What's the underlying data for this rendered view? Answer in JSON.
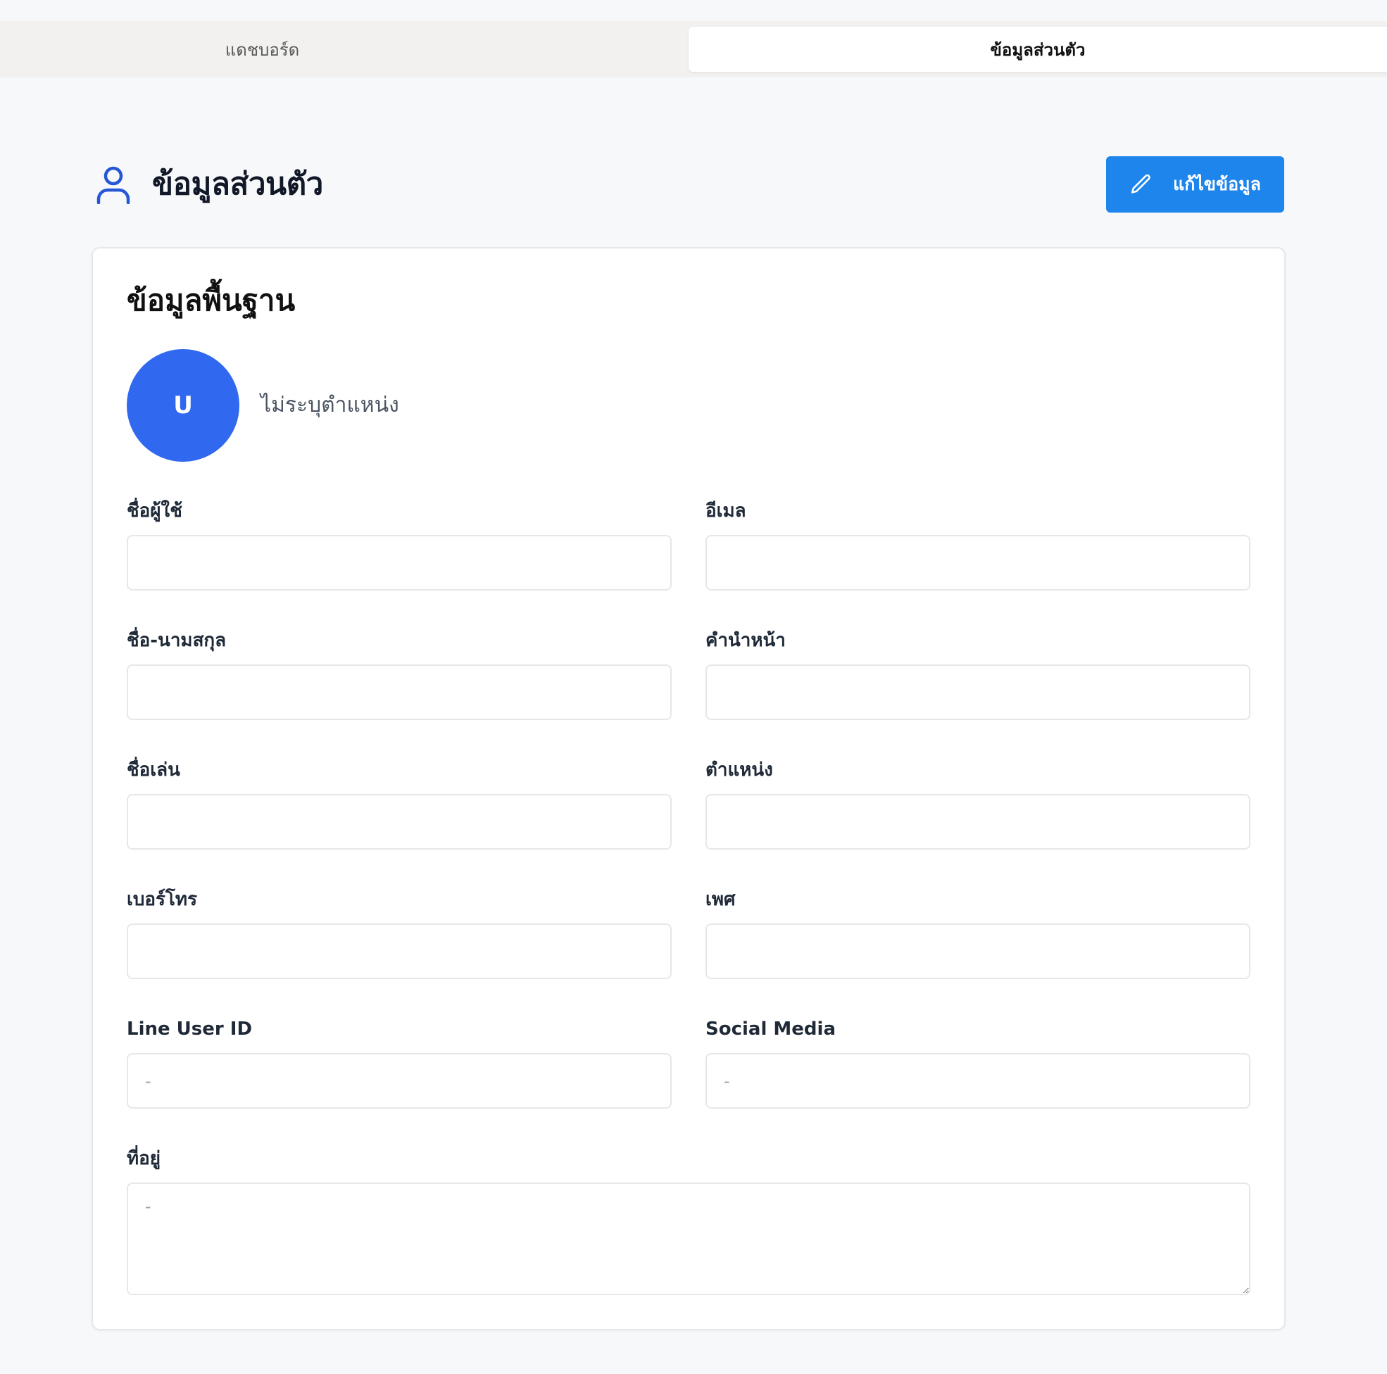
{
  "tabs": [
    {
      "label": "แดชบอร์ด"
    },
    {
      "label": "ข้อมูลส่วนตัว"
    }
  ],
  "header": {
    "title": "ข้อมูลส่วนตัว",
    "icon": "user-icon",
    "edit_button_label": "แก้ไขข้อมูล",
    "edit_icon": "pencil-icon"
  },
  "card": {
    "title": "ข้อมูลพื้นฐาน",
    "avatar_initial": "U",
    "position_text": "ไม่ระบุตำแหน่ง"
  },
  "fields": {
    "username": {
      "label": "ชื่อผู้ใช้",
      "value": "",
      "placeholder": ""
    },
    "email": {
      "label": "อีเมล",
      "value": "",
      "placeholder": ""
    },
    "fullname": {
      "label": "ชื่อ-นามสกุล",
      "value": "",
      "placeholder": ""
    },
    "prefix": {
      "label": "คำนำหน้า",
      "value": "",
      "placeholder": ""
    },
    "nickname": {
      "label": "ชื่อเล่น",
      "value": "",
      "placeholder": ""
    },
    "position": {
      "label": "ตำแหน่ง",
      "value": "",
      "placeholder": ""
    },
    "phone": {
      "label": "เบอร์โทร",
      "value": "",
      "placeholder": ""
    },
    "gender": {
      "label": "เพศ",
      "value": "",
      "placeholder": ""
    },
    "line_user_id": {
      "label": "Line User ID",
      "value": "",
      "placeholder": "-"
    },
    "social_media": {
      "label": "Social Media",
      "value": "",
      "placeholder": "-"
    },
    "address": {
      "label": "ที่อยู่",
      "value": "",
      "placeholder": "-"
    }
  },
  "colors": {
    "accent": "#1d85ec",
    "avatar": "#3068f0",
    "icon": "#2557d6"
  }
}
